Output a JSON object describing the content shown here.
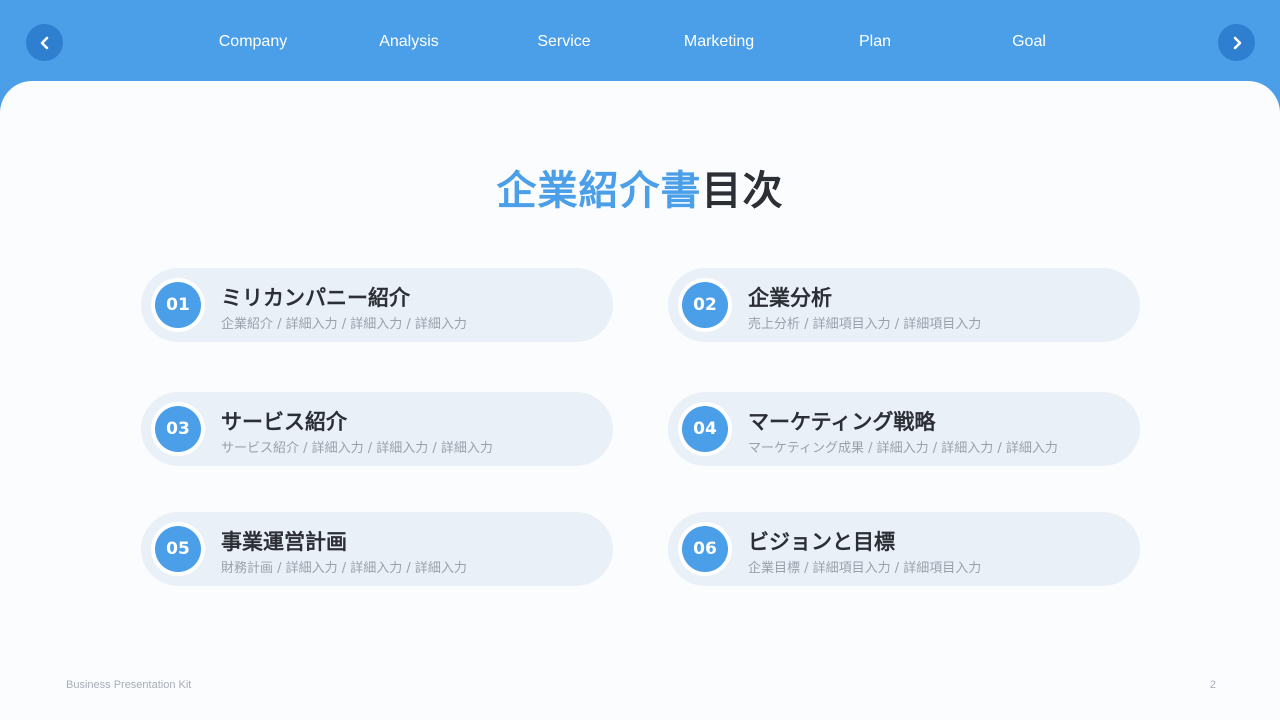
{
  "nav": {
    "prev_icon": "chevron-left-icon",
    "next_icon": "chevron-right-icon",
    "items": [
      {
        "label": "Company"
      },
      {
        "label": "Analysis"
      },
      {
        "label": "Service"
      },
      {
        "label": "Marketing"
      },
      {
        "label": "Plan"
      },
      {
        "label": "Goal"
      }
    ]
  },
  "title": {
    "accent": "企業紹介書",
    "rest": "目次"
  },
  "cards": [
    {
      "number": "01",
      "title": "ミリカンパニー紹介",
      "subtitle": "企業紹介 / 詳細入力 / 詳細入力 / 詳細入力"
    },
    {
      "number": "02",
      "title": "企業分析",
      "subtitle": "売上分析 / 詳細項目入力 / 詳細項目入力"
    },
    {
      "number": "03",
      "title": "サービス紹介",
      "subtitle": "サービス紹介 / 詳細入力 / 詳細入力 / 詳細入力"
    },
    {
      "number": "04",
      "title": "マーケティング戦略",
      "subtitle": "マーケティング成果 / 詳細入力 / 詳細入力 / 詳細入力"
    },
    {
      "number": "05",
      "title": "事業運営計画",
      "subtitle": "財務計画 / 詳細入力 / 詳細入力 / 詳細入力"
    },
    {
      "number": "06",
      "title": "ビジョンと目標",
      "subtitle": "企業目標 / 詳細項目入力 / 詳細項目入力"
    }
  ],
  "footer": {
    "brand": "Business Presentation Kit",
    "page_number": "2"
  },
  "colors": {
    "accent": "#4a9fe8",
    "dark_text": "#2c2f36",
    "card_bg": "#e9f0f8"
  }
}
